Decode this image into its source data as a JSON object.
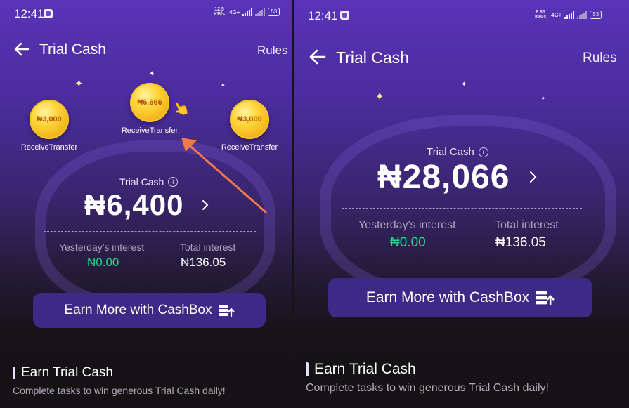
{
  "left_screen": {
    "status_bar": {
      "time": "12:41",
      "net_speed": "12.5 KB/s",
      "network": "4G+",
      "battery": "53"
    },
    "header": {
      "title": "Trial Cash",
      "rules_label": "Rules"
    },
    "coins": [
      {
        "amount": "₦3,000",
        "label": "ReceiveTransfer"
      },
      {
        "amount": "₦6,666",
        "label": "ReceiveTransfer"
      },
      {
        "amount": "₦3,000",
        "label": "ReceiveTransfer"
      }
    ],
    "trial_cash_label": "Trial Cash",
    "trial_cash_amount": "₦6,400",
    "yesterday_label": "Yesterday's interest",
    "yesterday_value": "₦0.00",
    "total_label": "Total interest",
    "total_value": "₦136.05",
    "cashbox_button": "Earn More with CashBox",
    "earn_title": "Earn Trial Cash",
    "earn_subtitle": "Complete tasks to win generous Trial Cash daily!"
  },
  "right_screen": {
    "status_bar": {
      "time": "12:41",
      "net_speed": "6.85 KB/s",
      "network": "4G+",
      "battery": "53"
    },
    "header": {
      "title": "Trial Cash",
      "rules_label": "Rules"
    },
    "trial_cash_label": "Trial Cash",
    "trial_cash_amount": "₦28,066",
    "yesterday_label": "Yesterday's interest",
    "yesterday_value": "₦0.00",
    "total_label": "Total interest",
    "total_value": "₦136.05",
    "cashbox_button": "Earn More with CashBox",
    "earn_title": "Earn Trial Cash",
    "earn_subtitle": "Complete tasks to win generous Trial Cash daily!"
  },
  "icons": {
    "back": "arrow-left-icon",
    "info": "info-icon",
    "chevron": "chevron-right-icon",
    "cashbox": "cashbox-icon",
    "hand": "pointing-hand-icon",
    "annotation": "orange-arrow"
  },
  "colors": {
    "purple_top": "#5a33b8",
    "dark_bottom": "#141214",
    "green_value": "#1ed98a",
    "button_bg": "#3c2a86",
    "coin_gold": "#ffd53a",
    "annotation_arrow": "#f07a4a"
  }
}
